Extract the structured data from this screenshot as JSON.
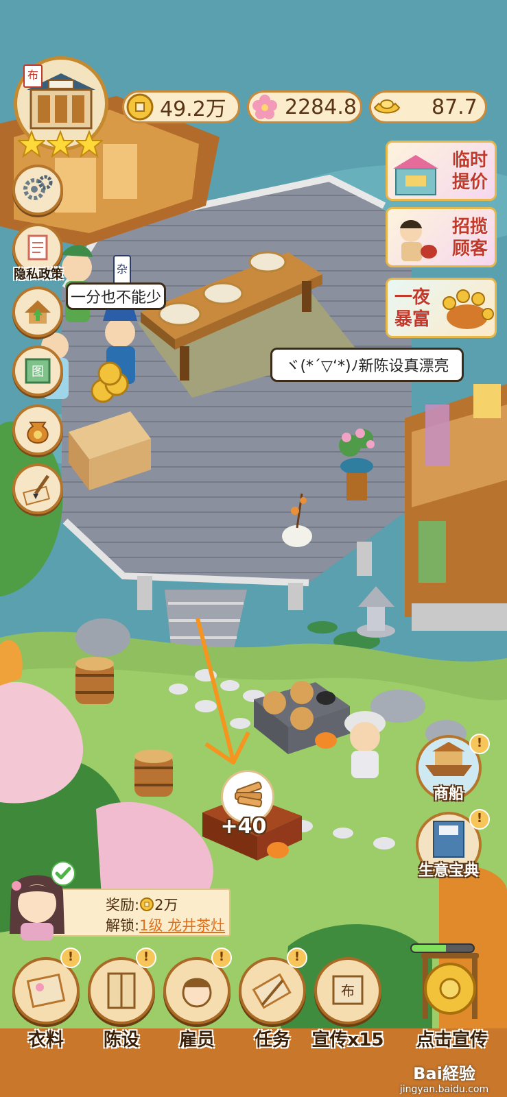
{
  "currencies": {
    "coins": "49.2万",
    "blossoms": "2284.8",
    "ingots": "87.7"
  },
  "shop": {
    "stars": 3,
    "sign": "布"
  },
  "side_menu": {
    "settings_icon": "gears-icon",
    "privacy_label": "隐私政策",
    "upgrade_icon": "house-up-icon",
    "map_icon": "picture-icon",
    "bag_icon": "money-bag-icon",
    "decorate_icon": "brush-icon"
  },
  "promos": [
    {
      "label_line1": "临时",
      "label_line2": "提价"
    },
    {
      "label_line1": "招揽",
      "label_line2": "顾客"
    },
    {
      "label_line1": "一夜",
      "label_line2": "暴富"
    }
  ],
  "speech": {
    "left_bubble": "一分也不能少",
    "right_bubble": "ヾ(*´▽‘*)ﾉ新陈设真漂亮",
    "sign_char": "杂"
  },
  "stove": {
    "gain": "+40"
  },
  "right_buttons": {
    "merchant_ship": "商船",
    "business_guide": "生意宝典"
  },
  "quest": {
    "reward_label": "奖励:",
    "reward_value": "2万",
    "unlock_label": "解锁:",
    "unlock_value": "1级 龙井茶灶"
  },
  "promo_progress": 0.55,
  "bottom_nav": [
    {
      "label": "衣料",
      "icon": "fabric-scroll-icon"
    },
    {
      "label": "陈设",
      "icon": "cabinet-icon"
    },
    {
      "label": "雇员",
      "icon": "employee-icon"
    },
    {
      "label": "任务",
      "icon": "scroll-brush-icon"
    },
    {
      "label": "宣传x15",
      "icon": "banner-icon"
    },
    {
      "label": "点击宣传",
      "icon": "gong-icon"
    }
  ],
  "watermark": {
    "brand": "Bai経验",
    "url": "jingyan.baidu.com"
  }
}
